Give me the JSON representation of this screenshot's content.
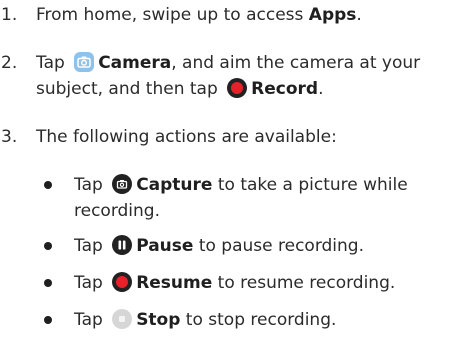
{
  "steps": [
    {
      "num": "1.",
      "pre": "From home, swipe up to access ",
      "bold": "Apps",
      "post": "."
    },
    {
      "num": "2.",
      "pre": "Tap ",
      "bold1": "Camera",
      "mid": ", and aim the camera at your subject, and then tap ",
      "bold2": "Record",
      "post": "."
    },
    {
      "num": "3.",
      "text": "The following actions are available:"
    }
  ],
  "actions": [
    {
      "pre": "Tap ",
      "bold": "Capture",
      "post": " to take a picture while recording."
    },
    {
      "pre": "Tap ",
      "bold": "Pause",
      "post": " to pause recording."
    },
    {
      "pre": "Tap ",
      "bold": "Resume",
      "post": " to resume recording."
    },
    {
      "pre": "Tap ",
      "bold": "Stop",
      "post": " to stop recording."
    }
  ],
  "icons": {
    "camera": "camera-app-icon",
    "record": "record-icon",
    "capture": "capture-icon",
    "pause": "pause-icon",
    "resume": "resume-icon",
    "stop": "stop-icon"
  },
  "colors": {
    "camera_bg": "#8fc2ea",
    "record_red": "#e8202a",
    "dark": "#222222",
    "stop_gray": "#d6d6d6"
  }
}
